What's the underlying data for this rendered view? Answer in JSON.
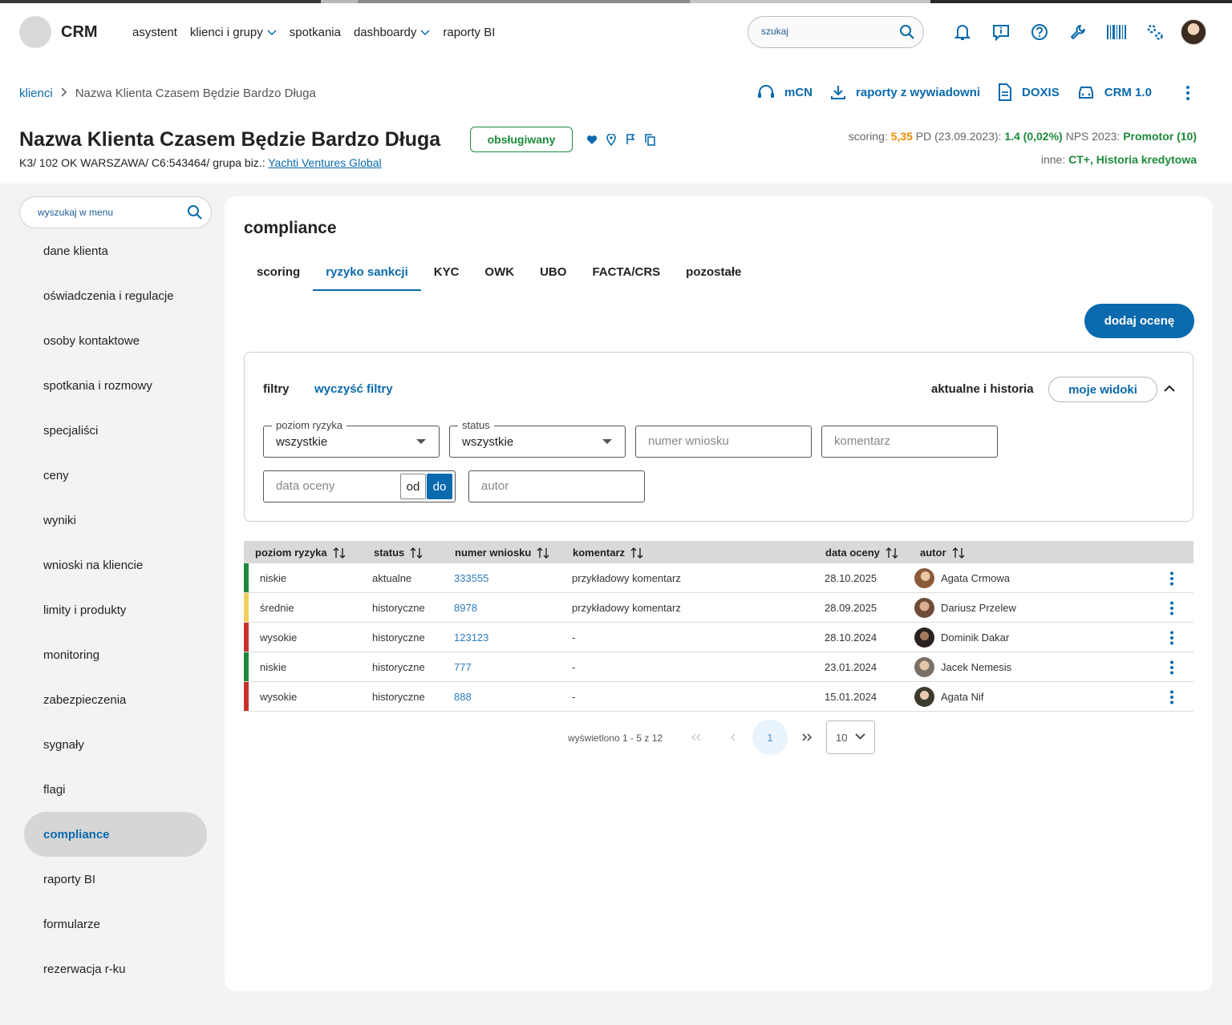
{
  "colors": {
    "accent": "#0a6aad",
    "green": "#1c8a3a",
    "orange": "#f08c00",
    "risk_low": "#1c8a3a",
    "risk_mid": "#f2cf5b",
    "risk_high": "#c9302c"
  },
  "app": {
    "logo": "CRM",
    "nav": [
      {
        "label": "asystent",
        "has_dropdown": false
      },
      {
        "label": "klienci i grupy",
        "has_dropdown": true
      },
      {
        "label": "spotkania",
        "has_dropdown": false
      },
      {
        "label": "dashboardy",
        "has_dropdown": true
      },
      {
        "label": "raporty BI",
        "has_dropdown": false
      }
    ],
    "search_placeholder": "szukaj",
    "icons": [
      "bell-icon",
      "info-icon",
      "help-icon",
      "wrench-icon",
      "barcode-icon",
      "settings-icon"
    ]
  },
  "breadcrumb": {
    "root": "klienci",
    "current": "Nazwa Klienta Czasem Będzie Bardzo Długa"
  },
  "quick_links": [
    {
      "label": "mCN",
      "icon": "headset-icon"
    },
    {
      "label": "raporty z wywiadowni",
      "icon": "download-icon"
    },
    {
      "label": "DOXIS",
      "icon": "document-icon"
    },
    {
      "label": "CRM 1.0",
      "icon": "car-icon"
    }
  ],
  "client": {
    "name": "Nazwa Klienta Czasem Będzie Bardzo Długa",
    "status": "obsługiwany",
    "subline": "K3/ 102 OK WARSZAWA/ C6:543464/ grupa biz.: ",
    "group_link": "Yachti Ventures Global",
    "scoring_label": "scoring: ",
    "scoring_value": "5,35",
    "pd_label": " PD (23.09.2023): ",
    "pd_value": "1.4 (0,02%)",
    "nps_label": " NPS 2023: ",
    "nps_value": "Promotor (10)",
    "inne_label": "inne: ",
    "inne_value": "CT+, Historia kredytowa"
  },
  "sidebar": {
    "search_placeholder": "wyszukaj w menu",
    "items": [
      {
        "label": "dane klienta",
        "active": false
      },
      {
        "label": "oświadczenia i regulacje",
        "active": false
      },
      {
        "label": "osoby kontaktowe",
        "active": false
      },
      {
        "label": "spotkania i rozmowy",
        "active": false
      },
      {
        "label": "specjaliści",
        "active": false
      },
      {
        "label": "ceny",
        "active": false
      },
      {
        "label": "wyniki",
        "active": false
      },
      {
        "label": "wnioski na kliencie",
        "active": false
      },
      {
        "label": "limity i produkty",
        "active": false
      },
      {
        "label": "monitoring",
        "active": false
      },
      {
        "label": "zabezpieczenia",
        "active": false
      },
      {
        "label": "sygnały",
        "active": false
      },
      {
        "label": "flagi",
        "active": false
      },
      {
        "label": "compliance",
        "active": true
      },
      {
        "label": "raporty BI",
        "active": false
      },
      {
        "label": "formularze",
        "active": false
      },
      {
        "label": "rezerwacja r-ku",
        "active": false
      }
    ]
  },
  "main": {
    "title": "compliance",
    "tabs": [
      {
        "label": "scoring",
        "active": false
      },
      {
        "label": "ryzyko sankcji",
        "active": true
      },
      {
        "label": "KYC",
        "active": false
      },
      {
        "label": "OWK",
        "active": false
      },
      {
        "label": "UBO",
        "active": false
      },
      {
        "label": "FACTA/CRS",
        "active": false
      },
      {
        "label": "pozostałe",
        "active": false
      }
    ],
    "add_button": "dodaj ocenę"
  },
  "filters": {
    "label": "filtry",
    "clear": "wyczyść filtry",
    "history": "aktualne i historia",
    "views": "moje widoki",
    "risk_legend": "poziom ryzyka",
    "risk_value": "wszystkie",
    "status_legend": "status",
    "status_value": "wszystkie",
    "number_placeholder": "numer wniosku",
    "comment_placeholder": "komentarz",
    "date_placeholder": "data oceny",
    "od": "od",
    "do": "do",
    "author_placeholder": "autor"
  },
  "table": {
    "columns": [
      "poziom ryzyka",
      "status",
      "numer wniosku",
      "komentarz",
      "data oceny",
      "autor"
    ],
    "rows": [
      {
        "risk": "niskie",
        "level": "low",
        "status": "aktualne",
        "number": "333555",
        "comment": "przykładowy komentarz",
        "date": "28.10.2025",
        "author": "Agata Crmowa"
      },
      {
        "risk": "średnie",
        "level": "mid",
        "status": "historyczne",
        "number": "8978",
        "comment": "przykładowy komentarz",
        "date": "28.09.2025",
        "author": "Dariusz Przelew"
      },
      {
        "risk": "wysokie",
        "level": "high",
        "status": "historyczne",
        "number": "123123",
        "comment": "-",
        "date": "28.10.2024",
        "author": "Dominik Dakar"
      },
      {
        "risk": "niskie",
        "level": "low",
        "status": "historyczne",
        "number": "777",
        "comment": "-",
        "date": "23.01.2024",
        "author": "Jacek Nemesis"
      },
      {
        "risk": "wysokie",
        "level": "high",
        "status": "historyczne",
        "number": "888",
        "comment": "-",
        "date": "15.01.2024",
        "author": "Agata Nif"
      }
    ]
  },
  "pagination": {
    "info": "wyświetlono 1 - 5 z 12",
    "current_page": "1",
    "page_size": "10"
  }
}
